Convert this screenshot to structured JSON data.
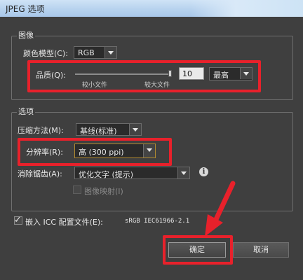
{
  "window": {
    "title": "JPEG 选项"
  },
  "image_group": {
    "label": "图像",
    "color_model_label": "颜色模型(C):",
    "color_model_value": "RGB",
    "quality_label": "品质(Q):",
    "quality_min_label": "较小文件",
    "quality_max_label": "较大文件",
    "quality_value": "10",
    "quality_level": 0.98,
    "quality_preset": "最高"
  },
  "options_group": {
    "label": "选项",
    "compression_label": "压缩方法(M):",
    "compression_value": "基线(标准)",
    "resolution_label": "分辨率(R):",
    "resolution_value": "高 (300 ppi)",
    "antialias_label": "消除锯齿(A):",
    "antialias_value": "优化文字 (提示)",
    "imagemap_label": "图像映射(I)"
  },
  "icc": {
    "checked": true,
    "label": "嵌入 ICC 配置文件(E):",
    "profile": "sRGB IEC61966-2.1"
  },
  "buttons": {
    "ok": "确定",
    "cancel": "取消"
  },
  "colors": {
    "highlight": "#e8212b",
    "dialog_bg": "#404040"
  }
}
